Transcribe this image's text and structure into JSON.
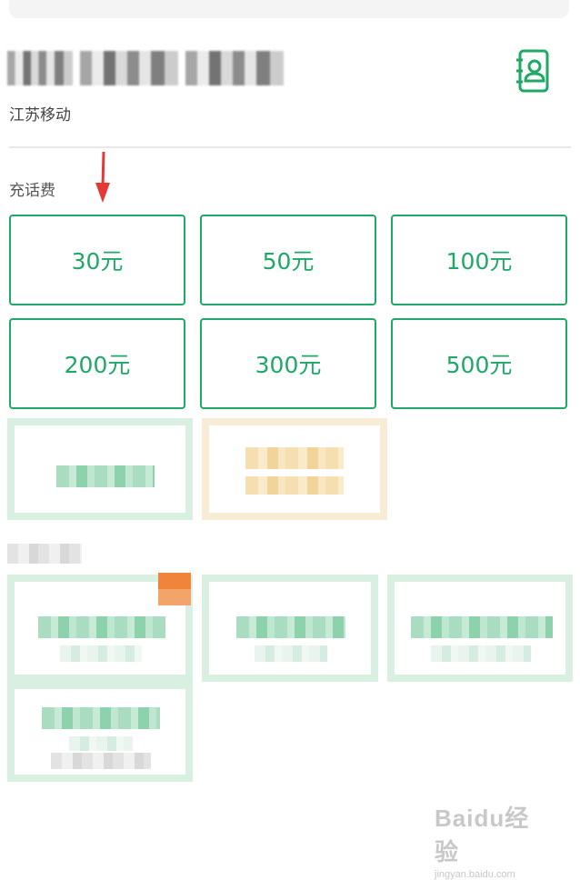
{
  "header": {
    "carrier": "江苏移动"
  },
  "section": {
    "title": "充话费"
  },
  "amounts": [
    {
      "label": "30元"
    },
    {
      "label": "50元"
    },
    {
      "label": "100元"
    },
    {
      "label": "200元"
    },
    {
      "label": "300元"
    },
    {
      "label": "500元"
    }
  ],
  "colors": {
    "accent": "#1fa866",
    "arrow": "#e53935"
  },
  "icons": {
    "contacts": "contacts-book-icon"
  },
  "watermark": {
    "logo": "Baidu经验",
    "url": "jingyan.baidu.com"
  }
}
